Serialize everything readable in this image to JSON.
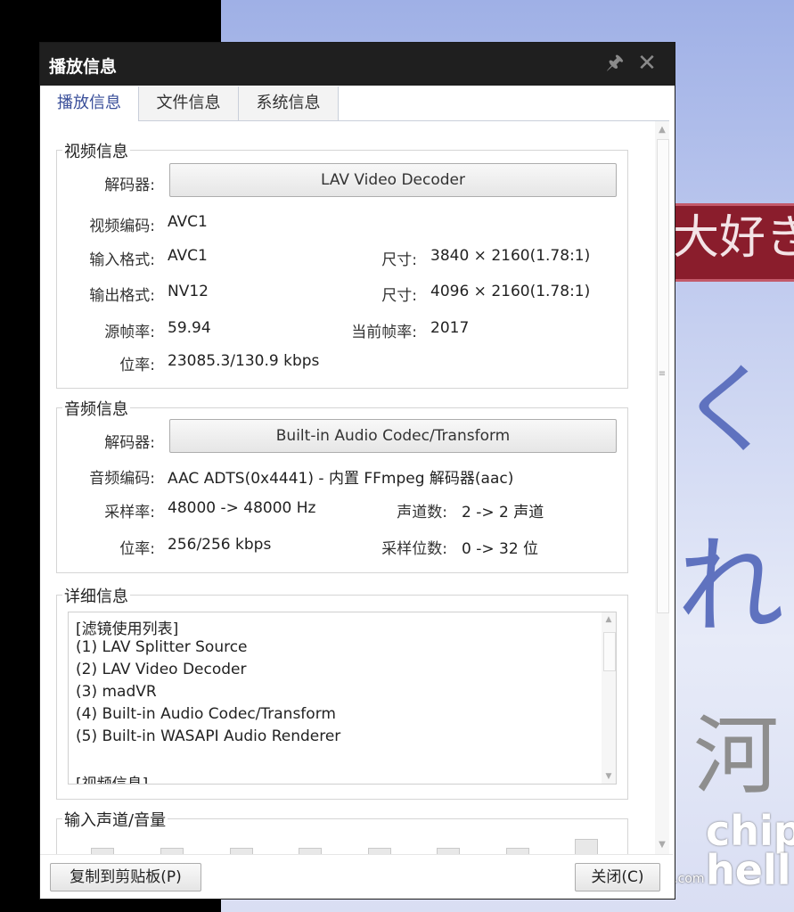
{
  "dialog": {
    "title": "播放信息",
    "pin_icon": "pin-icon",
    "close_icon": "close-icon"
  },
  "tabs": [
    {
      "label": "播放信息",
      "active": true
    },
    {
      "label": "文件信息",
      "active": false
    },
    {
      "label": "系统信息",
      "active": false
    }
  ],
  "video": {
    "legend": "视频信息",
    "decoder_label": "解码器:",
    "decoder_value": "LAV Video Decoder",
    "codec_label": "视频编码:",
    "codec_value": "AVC1",
    "input_format_label": "输入格式:",
    "input_format_value": "AVC1",
    "input_size_label": "尺寸:",
    "input_size_value": "3840 × 2160(1.78:1)",
    "output_format_label": "输出格式:",
    "output_format_value": "NV12",
    "output_size_label": "尺寸:",
    "output_size_value": "4096 × 2160(1.78:1)",
    "src_fps_label": "源帧率:",
    "src_fps_value": "59.94",
    "cur_fps_label": "当前帧率:",
    "cur_fps_value": "2017",
    "bitrate_label": "位率:",
    "bitrate_value": "23085.3/130.9 kbps"
  },
  "audio": {
    "legend": "音频信息",
    "decoder_label": "解码器:",
    "decoder_value": "Built-in Audio Codec/Transform",
    "codec_label": "音频编码:",
    "codec_value": "AAC ADTS(0x4441) - 内置 FFmpeg 解码器(aac)",
    "samplerate_label": "采样率:",
    "samplerate_value": "48000 -> 48000 Hz",
    "channels_label": "声道数:",
    "channels_value": "2 -> 2 声道",
    "bitrate_label": "位率:",
    "bitrate_value": "256/256 kbps",
    "bitdepth_label": "采样位数:",
    "bitdepth_value": "0 -> 32 位"
  },
  "details": {
    "legend": "详细信息",
    "lines": [
      "[滤镜使用列表]",
      " (1) LAV Splitter Source",
      " (2) LAV Video Decoder",
      " (3) madVR",
      " (4) Built-in Audio Codec/Transform",
      " (5) Built-in WASAPI Audio Renderer",
      "",
      "[视频信息]"
    ]
  },
  "volume": {
    "legend": "输入声道/音量"
  },
  "footer": {
    "copy_label": "复制到剪贴板(P)",
    "close_label": "关闭(C)"
  },
  "background": {
    "banner_text": "大好き",
    "kana1": "く",
    "kana2": "れ",
    "kanji": "河",
    "logo_text": "chip hell",
    "watermark_url": "www.chiphell.com"
  }
}
